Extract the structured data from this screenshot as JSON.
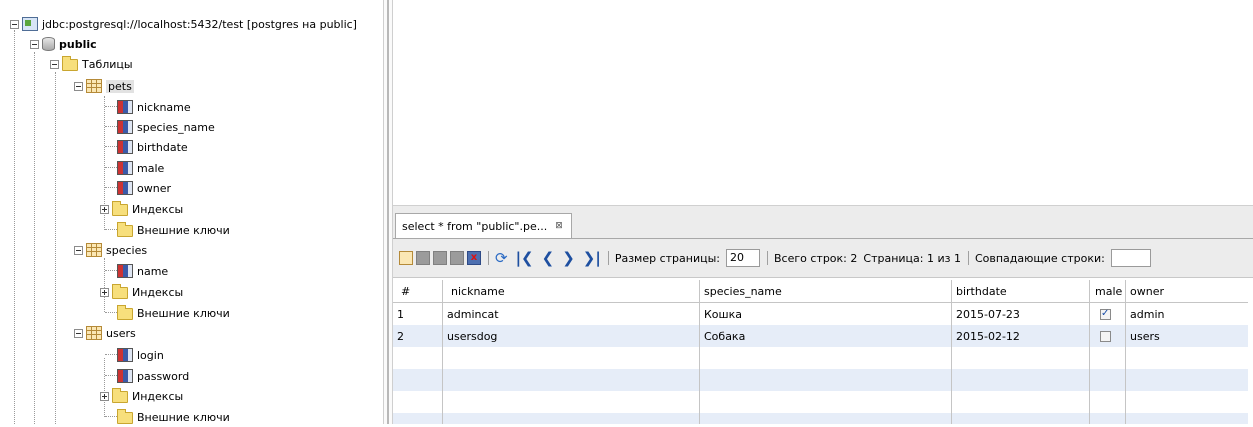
{
  "tree": {
    "connection": "jdbc:postgresql://localhost:5432/test [postgres на public]",
    "schema": "public",
    "tables_folder": "Таблицы",
    "tables": [
      {
        "name": "pets",
        "columns": [
          "nickname",
          "species_name",
          "birthdate",
          "male",
          "owner"
        ],
        "indexes": "Индексы",
        "foreign_keys": "Внешние ключи"
      },
      {
        "name": "species",
        "columns": [
          "name"
        ],
        "indexes": "Индексы",
        "foreign_keys": "Внешние ключи"
      },
      {
        "name": "users",
        "columns": [
          "login",
          "password"
        ],
        "indexes": "Индексы",
        "foreign_keys": "Внешние ключи"
      }
    ]
  },
  "result": {
    "tab_label": "select * from \"public\".pe...",
    "tab_close": "⊠",
    "toolbar": {
      "page_size_label": "Размер страницы:",
      "page_size_value": "20",
      "total_rows": "Всего строк: 2",
      "page_info": "Страница: 1 из 1",
      "matching_rows_label": "Совпадающие строки:"
    },
    "columns": [
      "#",
      "nickname",
      "species_name",
      "birthdate",
      "male",
      "owner"
    ],
    "rows": [
      {
        "num": "1",
        "nickname": "admincat",
        "species_name": "Кошка",
        "birthdate": "2015-07-23",
        "male": true,
        "owner": "admin"
      },
      {
        "num": "2",
        "nickname": "usersdog",
        "species_name": "Собака",
        "birthdate": "2015-02-12",
        "male": false,
        "owner": "users"
      }
    ]
  }
}
